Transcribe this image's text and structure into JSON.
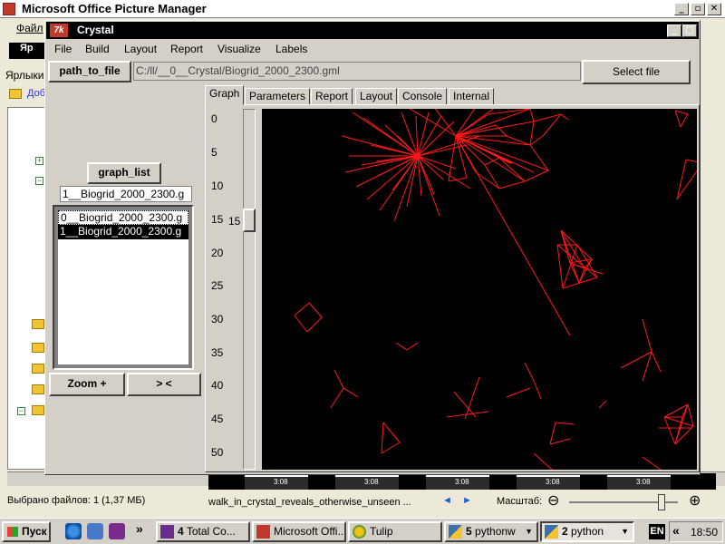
{
  "bg_app": {
    "title": "Microsoft Office Picture Manager",
    "menu_file": "Файл",
    "toolbar_label": "Яр",
    "shortcuts_label": "Ярлыки",
    "add_link": "Доб",
    "status_files": "Выбрано файлов: 1 (1,37 МБ)",
    "status_caption": "walk_in_crystal_reveals_otherwise_unseen ...",
    "nav_prev": "◄",
    "nav_next": "►",
    "zoom_label": "Масштаб:",
    "zoom_out": "⊖",
    "zoom_in": "⊕",
    "window_buttons": [
      "_",
      "▫",
      "✕"
    ],
    "thumb_label": "3:08"
  },
  "crystal": {
    "logo": "7k",
    "title": "Crystal",
    "window_buttons": [
      "_",
      "□",
      "✕"
    ],
    "menu": [
      "File",
      "Build",
      "Layout",
      "Report",
      "Visualize",
      "Labels"
    ],
    "path_button": "path_to_file",
    "path_value": "C:/ll/__0__Crystal/Biogrid_2000_2300.gml",
    "select_button": "Select file",
    "graph_list_button": "graph_list",
    "graph_list_current": "1__Biogrid_2000_2300.g",
    "graph_list_items": [
      "0__Biogrid_2000_2300.g",
      "1__Biogrid_2000_2300.g"
    ],
    "zoom_button": "Zoom +",
    "next_button": "> <",
    "tabs": [
      "Graph",
      "Parameters",
      "Report",
      "Layout",
      "Console",
      "Internal"
    ],
    "y_ticks": [
      "0",
      "5",
      "10",
      "15",
      "20",
      "25",
      "30",
      "35",
      "40",
      "45",
      "50"
    ],
    "slider_value": "15",
    "graph_edge_color": "#ff1a1a",
    "canvas_background": "#000000"
  },
  "taskbar": {
    "start": "Пуск",
    "quick_launch_more": "»",
    "tasks": [
      {
        "num": "4",
        "label": "Total Co...",
        "icon": "floppy-icon"
      },
      {
        "num": "",
        "label": "Microsoft Offi...",
        "icon": "picture-manager-icon"
      },
      {
        "num": "",
        "label": "Tulip",
        "icon": "tulip-icon"
      },
      {
        "num": "5",
        "label": "pythonw",
        "icon": "python-icon"
      },
      {
        "num": "2",
        "label": "python",
        "icon": "python-icon"
      }
    ],
    "lang": "EN",
    "tray_expand": "«",
    "clock": "18:50"
  }
}
